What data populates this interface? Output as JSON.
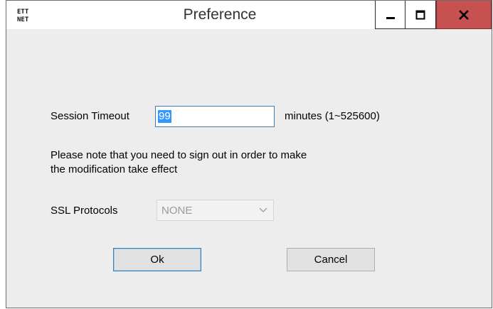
{
  "window": {
    "title": "Preference",
    "app_icon_text_line1": "ETT",
    "app_icon_text_line2": "NET"
  },
  "session_timeout": {
    "label": "Session Timeout",
    "value": "99",
    "unit_hint": "minutes (1~525600)"
  },
  "note": {
    "line1": "Please note that you need to sign out in order to make",
    "line2": "the modification take effect"
  },
  "ssl": {
    "label": "SSL Protocols",
    "selected": "NONE"
  },
  "buttons": {
    "ok_label": "Ok",
    "cancel_label": "Cancel"
  },
  "colors": {
    "close_button": "#c75050",
    "selection": "#3399ff",
    "focus_border": "#3c7fb1"
  }
}
